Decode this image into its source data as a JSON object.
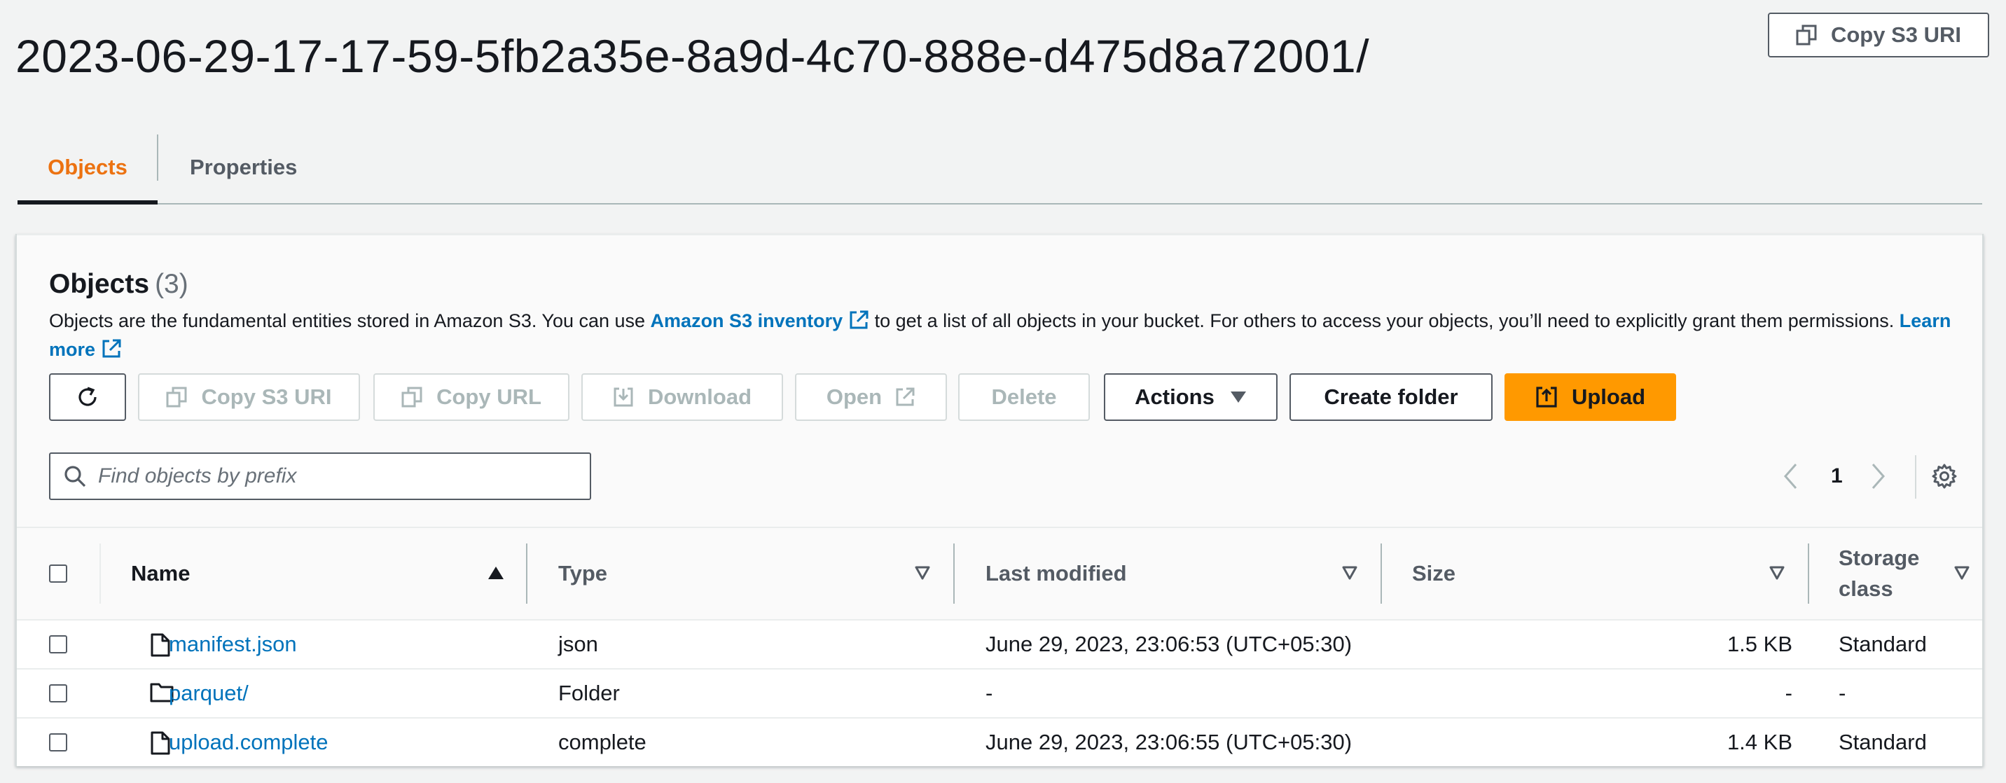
{
  "header": {
    "title": "2023-06-29-17-17-59-5fb2a35e-8a9d-4c70-888e-d475d8a72001/",
    "copy_s3_uri_label": "Copy S3 URI"
  },
  "tabs": [
    {
      "label": "Objects",
      "active": true
    },
    {
      "label": "Properties",
      "active": false
    }
  ],
  "objects_section": {
    "title": "Objects",
    "count": "(3)",
    "description_part1": "Objects are the fundamental entities stored in Amazon S3. You can use ",
    "inventory_link": "Amazon S3 inventory",
    "description_part2": " to get a list of all objects in your bucket. For others to access your objects, you’ll need to explicitly grant them permissions. ",
    "learn_more_link": "Learn more"
  },
  "toolbar": {
    "copy_s3_uri": "Copy S3 URI",
    "copy_url": "Copy URL",
    "download": "Download",
    "open": "Open",
    "delete": "Delete",
    "actions": "Actions",
    "create_folder": "Create folder",
    "upload": "Upload"
  },
  "search": {
    "placeholder": "Find objects by prefix",
    "value": ""
  },
  "pagination": {
    "current_page": "1"
  },
  "table": {
    "columns": [
      "Name",
      "Type",
      "Last modified",
      "Size",
      "Storage class"
    ],
    "rows": [
      {
        "name": "manifest.json",
        "icon": "file-icon",
        "type": "json",
        "last_modified": "June 29, 2023, 23:06:53 (UTC+05:30)",
        "size": "1.5 KB",
        "storage_class": "Standard"
      },
      {
        "name": "parquet/",
        "icon": "folder-icon",
        "type": "Folder",
        "last_modified": "-",
        "size": "-",
        "storage_class": "-"
      },
      {
        "name": "upload.complete",
        "icon": "file-icon",
        "type": "complete",
        "last_modified": "June 29, 2023, 23:06:55 (UTC+05:30)",
        "size": "1.4 KB",
        "storage_class": "Standard"
      }
    ]
  },
  "colors": {
    "accent_tab": "#ec7211",
    "link": "#0073bb",
    "primary_button": "#ff9900"
  }
}
